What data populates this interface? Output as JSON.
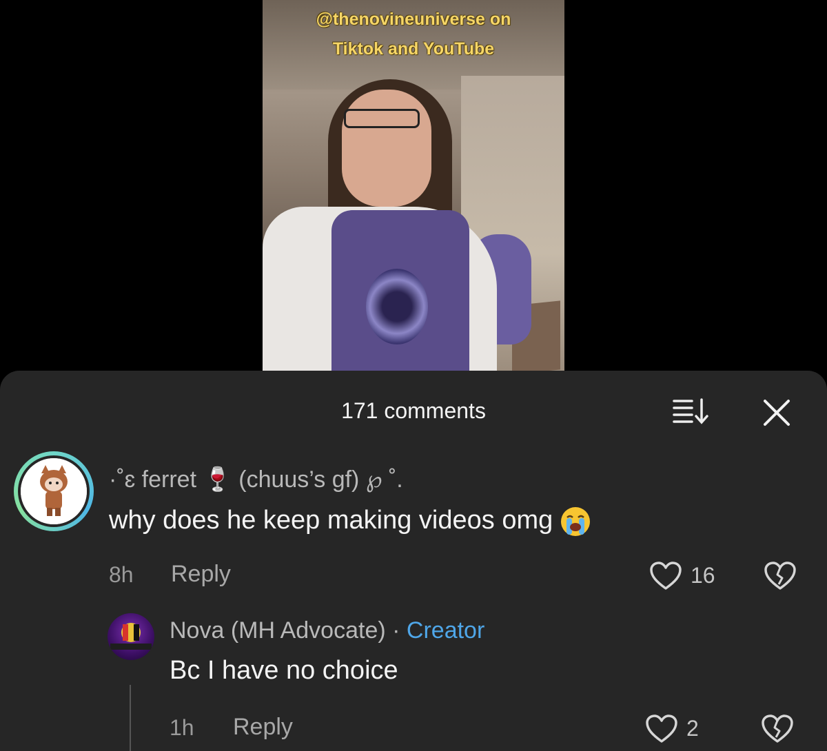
{
  "video": {
    "caption_line1": "@thenovineuniverse on",
    "caption_line2": "Tiktok and YouTube"
  },
  "comments_sheet": {
    "title": "171 comments",
    "sort_icon": "sort-icon",
    "close_icon": "close-icon"
  },
  "comment": {
    "username": "·˚ɛ ferret 🍷 (chuus’s gf) ℘ ˚.",
    "text": "why does he keep making videos omg",
    "emoji": "loudly-crying-face",
    "time": "8h",
    "reply_label": "Reply",
    "like_count": "16",
    "avatar_ring_color": "#4fb7e6"
  },
  "reply": {
    "username": "Nova (MH Advocate)",
    "separator": "·",
    "badge": "Creator",
    "text": "Bc I have no choice",
    "time": "1h",
    "reply_label": "Reply",
    "like_count": "2",
    "badge_color": "#4fa6e8"
  }
}
